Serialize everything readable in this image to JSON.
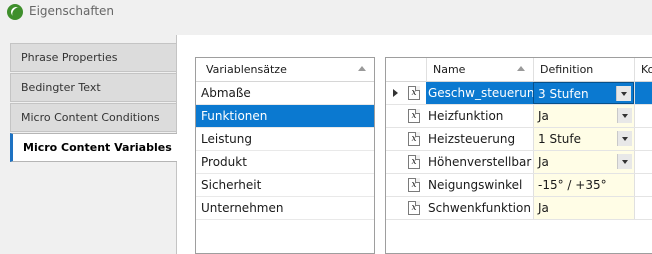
{
  "window": {
    "title": "Eigenschaften"
  },
  "tabs": [
    {
      "label": "Phrase Properties"
    },
    {
      "label": "Bedingter Text"
    },
    {
      "label": "Micro Content Conditions"
    },
    {
      "label": "Micro Content Variables"
    }
  ],
  "variable_sets": {
    "header": "Variablensätze",
    "items": [
      "Abmaße",
      "Funktionen",
      "Leistung",
      "Produkt",
      "Sicherheit",
      "Unternehmen"
    ],
    "selected": "Funktionen"
  },
  "variables_grid": {
    "columns": {
      "name": "Name",
      "definition": "Definition",
      "extra": "Ko"
    },
    "icon_glyph": "x",
    "rows": [
      {
        "name": "Geschw_steuerung",
        "definition": "3 Stufen"
      },
      {
        "name": "Heizfunktion",
        "definition": "Ja"
      },
      {
        "name": "Heizsteuerung",
        "definition": "1 Stufe"
      },
      {
        "name": "Höhenverstellbar",
        "definition": "Ja"
      },
      {
        "name": "Neigungswinkel",
        "definition": "-15° / +35°"
      },
      {
        "name": "Schwenkfunktion",
        "definition": "Ja"
      }
    ]
  },
  "colors": {
    "selection": "#0b79d0",
    "definition_bg": "#fffde6",
    "active_tab_accent": "#1e72c2"
  }
}
